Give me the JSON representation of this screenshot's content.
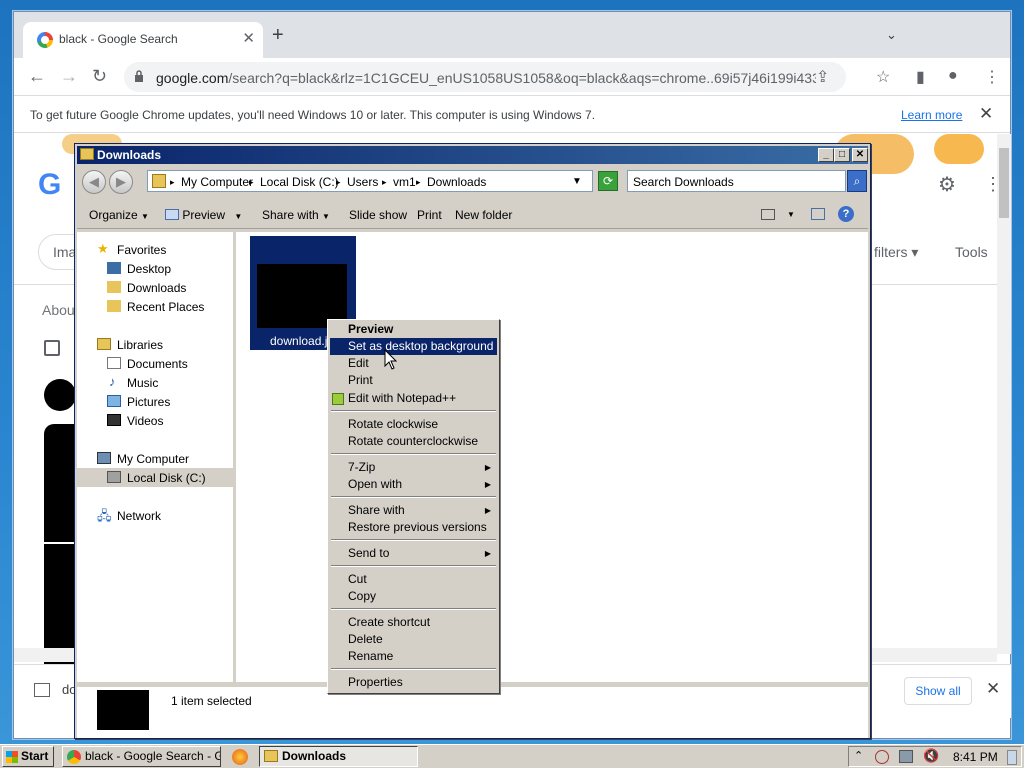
{
  "browser": {
    "tab_title": "black - Google Search",
    "url_host": "google.com",
    "url_path": "/search?q=black&rlz=1C1GCEU_enUS1058US1058&oq=black&aqs=chrome..69i57j46i199i433i4...",
    "infobar_message": "To get future Google Chrome updates, you'll need Windows 10 or later. This computer is using Windows 7.",
    "infobar_link": "Learn more",
    "page": {
      "images_tab": "Ima",
      "filters": "filters",
      "tools": "Tools",
      "about": "Abou",
      "download_prefix": "do",
      "show_all": "Show all"
    }
  },
  "explorer": {
    "title": "Downloads",
    "breadcrumb": [
      "My Computer",
      "Local Disk (C:)",
      "Users",
      "vm1",
      "Downloads"
    ],
    "search_placeholder": "Search Downloads",
    "commands": {
      "organize": "Organize",
      "preview": "Preview",
      "share_with": "Share with",
      "slide_show": "Slide show",
      "print": "Print",
      "new_folder": "New folder"
    },
    "nav": {
      "favorites": "Favorites",
      "desktop": "Desktop",
      "downloads": "Downloads",
      "recent_places": "Recent Places",
      "libraries": "Libraries",
      "documents": "Documents",
      "music": "Music",
      "pictures": "Pictures",
      "videos": "Videos",
      "my_computer": "My Computer",
      "local_disk": "Local Disk (C:)",
      "network": "Network"
    },
    "file_name": "download.jpg",
    "file_name_shown": "download.jp",
    "status": "1 item selected"
  },
  "context_menu": {
    "items": [
      "Preview",
      "Set as desktop background",
      "Edit",
      "Print",
      "Edit with Notepad++",
      "Rotate clockwise",
      "Rotate counterclockwise",
      "7-Zip",
      "Open with",
      "Share with",
      "Restore previous versions",
      "Send to",
      "Cut",
      "Copy",
      "Create shortcut",
      "Delete",
      "Rename",
      "Properties"
    ],
    "selected": "Set as desktop background"
  },
  "taskbar": {
    "start": "Start",
    "tasks": [
      "black - Google Search - G...",
      "Downloads"
    ],
    "clock": "8:41 PM"
  },
  "colors": {
    "selection": "#0a246a",
    "window_face": "#d4d0c8",
    "link_blue": "#1a73e8"
  }
}
